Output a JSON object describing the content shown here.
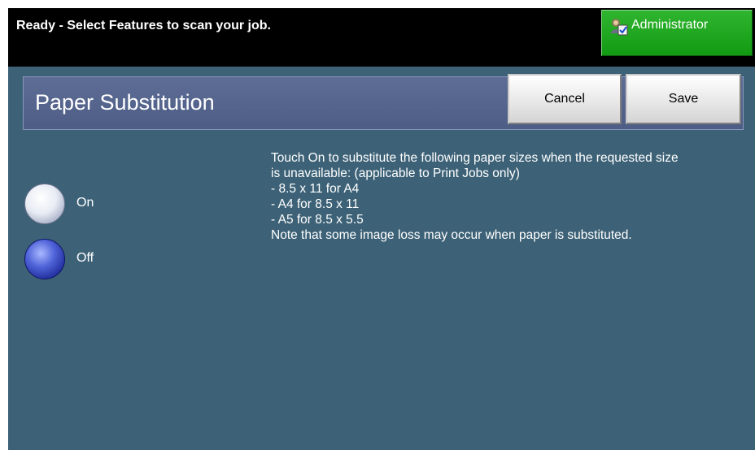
{
  "status_bar": {
    "message": "Ready - Select Features to scan your job.",
    "admin_button_label": "Administrator"
  },
  "header": {
    "title": "Paper Substitution",
    "cancel_label": "Cancel",
    "save_label": "Save"
  },
  "options": {
    "on_label": "On",
    "off_label": "Off",
    "selected": "Off"
  },
  "description": {
    "lines": [
      "Touch On to substitute the following paper sizes when the requested size",
      "is unavailable: (applicable to Print Jobs only)",
      "- 8.5 x 11 for A4",
      "- A4 for 8.5 x 11",
      "- A5 for 8.5 x 5.5",
      "Note that some image loss may occur when paper is substituted."
    ]
  },
  "colors": {
    "background": "#3d6277",
    "title_bar": "#56658d",
    "admin_green": "#1fa61f"
  },
  "icons": {
    "admin": "administrator-icon"
  }
}
